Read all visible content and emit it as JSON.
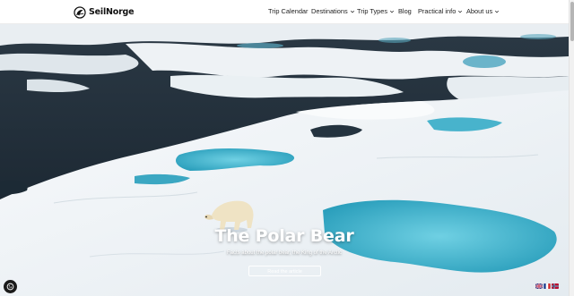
{
  "header": {
    "logo_text": "SeilNorge",
    "nav": [
      {
        "label": "Trip Calendar",
        "has_dropdown": false
      },
      {
        "label": "Destinations",
        "has_dropdown": true
      },
      {
        "label": "Trip Types",
        "has_dropdown": true
      },
      {
        "label": "Blog",
        "has_dropdown": false
      },
      {
        "label": "Practical info",
        "has_dropdown": true
      },
      {
        "label": "About us",
        "has_dropdown": true
      }
    ]
  },
  "hero": {
    "title": "The Polar Bear",
    "subtitle": "Facts about the polar bear, the King of the Arctic",
    "button_label": "Read the article"
  },
  "languages": [
    "English",
    "French",
    "Norwegian"
  ],
  "icons": {
    "logo": "seilnorge-logo-icon",
    "dropdown": "chevron-down-icon",
    "cookie": "cookie-settings-icon"
  },
  "colors": {
    "ice": "#f2f5f7",
    "melt_pond": "#3fb0c9",
    "sea": "#1e2a36",
    "text": "#222222"
  }
}
